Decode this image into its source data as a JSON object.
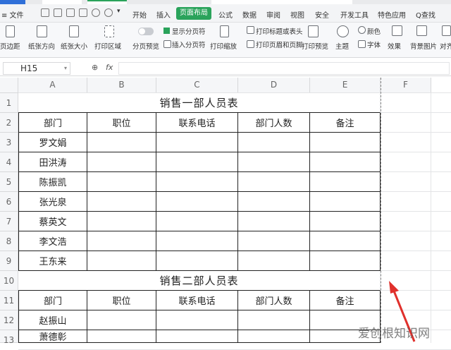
{
  "menu": {
    "file": "≡ 文件",
    "tabs": [
      "开始",
      "插入",
      "页面布局",
      "公式",
      "数据",
      "审阅",
      "视图",
      "安全",
      "开发工具",
      "特色应用"
    ],
    "active_tab": "页面布局",
    "search": "Q查找"
  },
  "ribbon": {
    "margins": "页边距",
    "orientation": "纸张方向",
    "size": "纸张大小",
    "print_area": "打印区域",
    "page_preview": "分页预览",
    "show_page_break": "显示分页符",
    "insert_page_break": "插入分页符",
    "print_scale": "打印缩放",
    "print_titles": "打印标题或表头",
    "header_footer": "打印页眉和页脚",
    "print_preview": "打印预览",
    "theme": "主题",
    "colors": "颜色",
    "fonts": "字体",
    "effects": "效果",
    "background": "背景图片",
    "align": "对齐"
  },
  "formula_bar": {
    "cell_ref": "H15",
    "fx": "fx",
    "value": ""
  },
  "columns": [
    "A",
    "B",
    "C",
    "D",
    "E",
    "F"
  ],
  "rows": [
    "1",
    "2",
    "3",
    "4",
    "5",
    "6",
    "7",
    "8",
    "9",
    "10",
    "11",
    "12",
    "13"
  ],
  "table1": {
    "title": "销售一部人员表",
    "headers": [
      "部门",
      "职位",
      "联系电话",
      "部门人数",
      "备注"
    ],
    "names": [
      "罗文娟",
      "田洪涛",
      "陈振凯",
      "张光泉",
      "蔡英文",
      "李文浩",
      "王东来"
    ]
  },
  "table2": {
    "title": "销售二部人员表",
    "headers": [
      "部门",
      "职位",
      "联系电话",
      "部门人数",
      "备注"
    ],
    "names": [
      "赵振山",
      "萧德彰"
    ]
  },
  "watermark": "爱创根知识网"
}
